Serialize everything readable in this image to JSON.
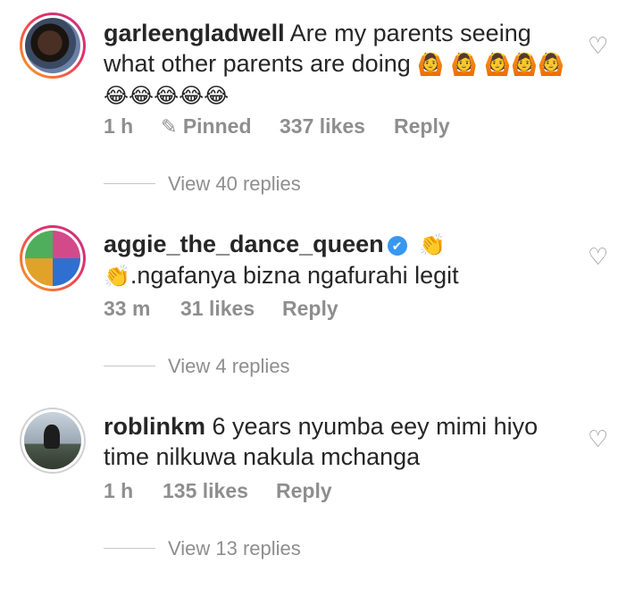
{
  "comments": [
    {
      "username": "garleengladwell",
      "text": "Are my parents seeing what other parents are doing",
      "emojis_line1": "🙆 🙆 🙆🙆🙆",
      "emojis_line2": "😂😂😂😂😂",
      "time": "1 h",
      "pinned_label": "Pinned",
      "likes": "337 likes",
      "reply_label": "Reply",
      "view_replies": "View 40 replies",
      "verified": false
    },
    {
      "username": "aggie_the_dance_queen",
      "verified_mark": "✔",
      "emojis": "👏👏",
      "text": ".ngafanya bizna ngafurahi legit",
      "time": "33 m",
      "likes": "31 likes",
      "reply_label": "Reply",
      "view_replies": "View 4 replies",
      "verified": true
    },
    {
      "username": "roblinkm",
      "text": "6 years nyumba eey mimi hiyo time nilkuwa nakula mchanga",
      "time": "1 h",
      "likes": "135 likes",
      "reply_label": "Reply",
      "view_replies": "View 13 replies",
      "verified": false
    }
  ],
  "icons": {
    "like": "heart-outline-icon",
    "pin": "pin-icon",
    "verified": "verified-badge-icon"
  },
  "heart_glyph": "♡",
  "pin_glyph": "✎",
  "colors": {
    "secondary_text": "#8e8e8e",
    "primary_text": "#262626",
    "verified_blue": "#3897f0"
  }
}
